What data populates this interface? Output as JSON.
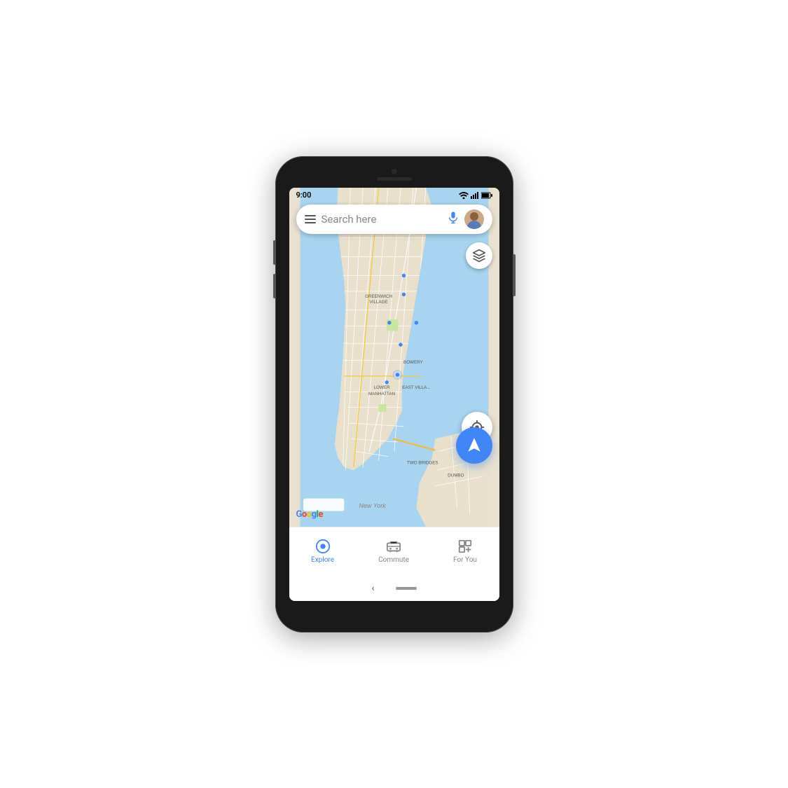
{
  "phone": {
    "status_bar": {
      "time": "9:00"
    },
    "search": {
      "placeholder": "Search here"
    },
    "map": {
      "google_logo": "Google"
    },
    "layers_button_label": "Map layers",
    "location_button_label": "My location",
    "navigate_button_label": "Navigate",
    "bottom_nav": {
      "items": [
        {
          "label": "Explore",
          "active": true,
          "icon": "explore-icon"
        },
        {
          "label": "Commute",
          "active": false,
          "icon": "commute-icon"
        },
        {
          "label": "For You",
          "active": false,
          "icon": "for-you-icon"
        }
      ]
    },
    "android_nav": {
      "back_label": "‹"
    }
  }
}
